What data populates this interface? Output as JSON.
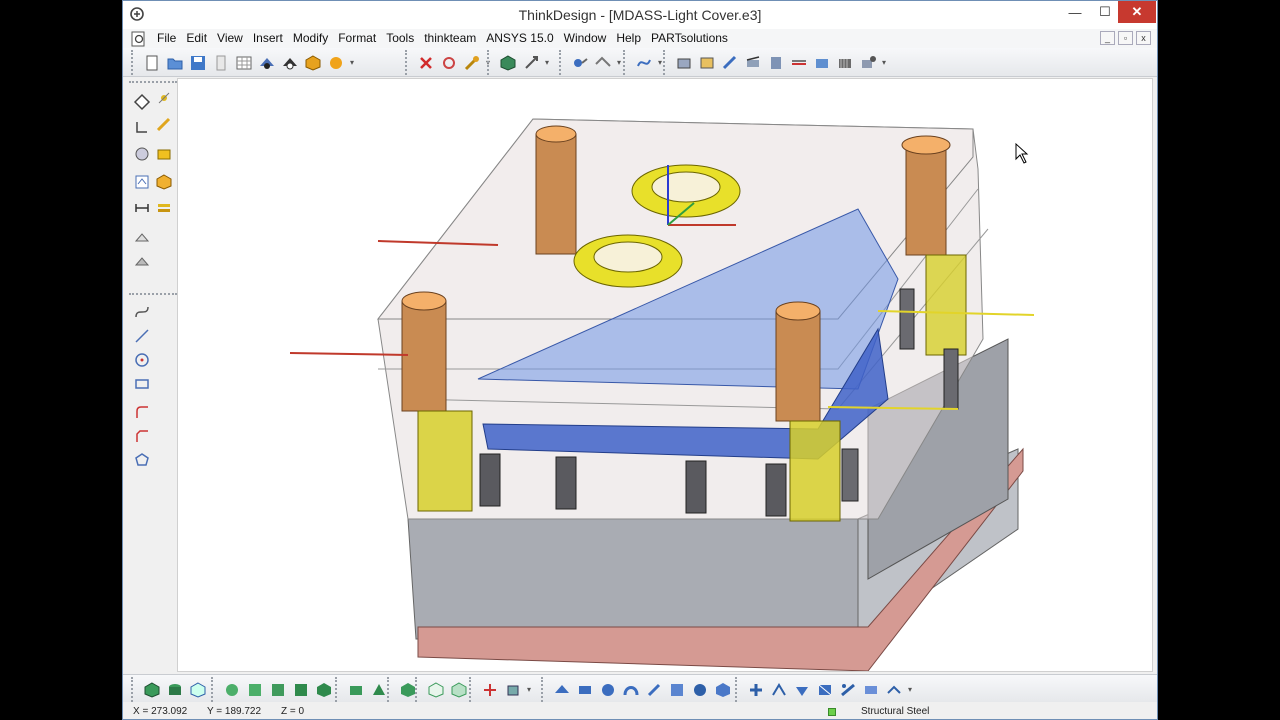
{
  "window": {
    "title": "ThinkDesign  - [MDASS-Light Cover.e3]",
    "controls": {
      "minimize": "—",
      "maximize": "☐",
      "close": "✕"
    }
  },
  "menu": {
    "items": [
      "File",
      "Edit",
      "View",
      "Insert",
      "Modify",
      "Format",
      "Tools",
      "thinkteam",
      "ANSYS 15.0",
      "Window",
      "Help",
      "PARTsolutions"
    ],
    "mdi_controls": [
      "_",
      "▫",
      "x"
    ]
  },
  "toolbars": {
    "top_icons": [
      "new-icon",
      "open-icon",
      "save-icon",
      "blank-page-icon",
      "table-icon",
      "hide-icon",
      "show-icon",
      "solid-icon",
      "sphere-icon",
      "delete-icon",
      "trim-icon",
      "tools-icon",
      "view-icon",
      "move-icon",
      "link-icon",
      "path-icon",
      "machine-1-icon",
      "machine-2-icon",
      "machine-3-icon",
      "machine-4-icon",
      "machine-5-icon",
      "machine-6-icon",
      "machine-7-icon",
      "machine-8-icon",
      "machine-9-icon"
    ],
    "left_icons": [
      "plane-icon",
      "point-icon",
      "edge-icon",
      "pencil-icon",
      "surface-icon",
      "tag-icon",
      "sketch-icon",
      "cube-icon",
      "dimension-icon",
      "layers-icon",
      "shell-icon",
      "shade-icon",
      "curve-icon",
      "line-icon",
      "circle-icon",
      "rectangle-icon",
      "fillet-icon",
      "chamfer-icon",
      "polygon-icon"
    ],
    "bottom_icons": [
      "box-icon",
      "cylinder-icon",
      "wireframe-icon",
      "face-1-icon",
      "face-2-icon",
      "face-3-icon",
      "face-4-icon",
      "face-5-icon",
      "block-icon",
      "mesh-icon",
      "green-block-icon",
      "outline-box-icon",
      "solid-box-icon",
      "axis-icon",
      "grab-icon",
      "blue-1-icon",
      "blue-2-icon",
      "blue-3-icon",
      "blue-4-icon",
      "blue-5-icon",
      "blue-6-icon",
      "blue-7-icon",
      "blue-8-icon",
      "blue-9-icon",
      "blue-10-icon",
      "blue-11-icon",
      "blue-12-icon",
      "blue-13-icon",
      "blue-14-icon",
      "blue-15-icon"
    ]
  },
  "status": {
    "x": "X = 273.092",
    "y": "Y = 189.722",
    "z": "Z = 0",
    "material": "Structural Steel"
  },
  "colors": {
    "accent": "#c7392f",
    "pillar": "#c98b52",
    "ring": "#e8e02a",
    "cavity": "#3f6bd6",
    "base_gray": "#a8abb3",
    "base_pink": "#d59a93"
  }
}
